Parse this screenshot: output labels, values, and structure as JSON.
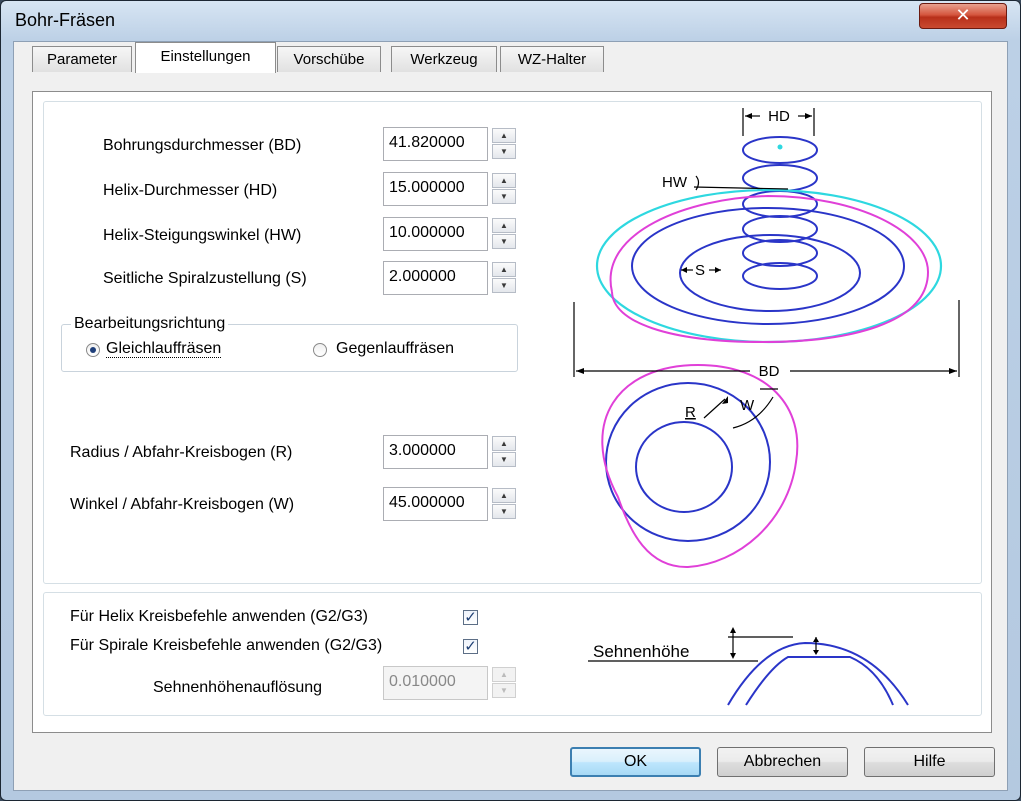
{
  "window": {
    "title": "Bohr-Fräsen",
    "close_glyph": "✕"
  },
  "tabs": [
    {
      "label": "Parameter",
      "active": false
    },
    {
      "label": "Einstellungen",
      "active": true
    },
    {
      "label": "Vorschübe",
      "active": false
    },
    {
      "label": "Werkzeug",
      "active": false
    },
    {
      "label": "WZ-Halter",
      "active": false
    }
  ],
  "fields": {
    "bd": {
      "label": "Bohrungsdurchmesser (BD)",
      "value": "41.820000"
    },
    "hd": {
      "label": "Helix-Durchmesser (HD)",
      "value": "15.000000"
    },
    "hw": {
      "label": "Helix-Steigungswinkel (HW)",
      "value": "10.000000"
    },
    "s": {
      "label": "Seitliche Spiralzustellung (S)",
      "value": "2.000000"
    },
    "r": {
      "label": "Radius / Abfahr-Kreisbogen (R)",
      "value": "3.000000"
    },
    "w": {
      "label": "Winkel / Abfahr-Kreisbogen (W)",
      "value": "45.000000"
    },
    "sehnen": {
      "label": "Sehnenhöhenauflösung",
      "value": "0.010000",
      "enabled": false
    }
  },
  "direction": {
    "legend": "Bearbeitungsrichtung",
    "options": [
      {
        "label": "Gleichlauffräsen",
        "selected": true
      },
      {
        "label": "Gegenlauffräsen",
        "selected": false
      }
    ]
  },
  "checkboxes": {
    "helix": {
      "label": "Für Helix Kreisbefehle anwenden (G2/G3)",
      "checked": true,
      "glyph": "✓"
    },
    "spirale": {
      "label": "Für Spirale Kreisbefehle anwenden (G2/G3)",
      "checked": true,
      "glyph": "✓"
    }
  },
  "diagram": {
    "hd": "HD",
    "hw": "HW",
    "s": "S",
    "bd": "BD",
    "r": "R",
    "w": "W",
    "sehnenhoehe": "Sehnenhöhe",
    "colors": {
      "cyan": "#2ed8e0",
      "magenta": "#e040d8",
      "blue": "#2a35c8"
    }
  },
  "buttons": {
    "ok": "OK",
    "cancel": "Abbrechen",
    "help": "Hilfe"
  },
  "spin_glyphs": {
    "up": "▲",
    "down": "▼"
  }
}
